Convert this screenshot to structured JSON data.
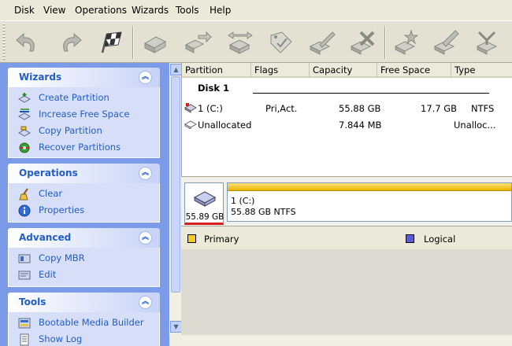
{
  "menu": [
    "Disk",
    "View",
    "Operations",
    "Wizards",
    "Tools",
    "Help"
  ],
  "toolbar": {
    "buttons": [
      "undo-icon",
      "redo-icon",
      "checkered-flag-icon",
      "disk-create-icon",
      "disk-move-icon",
      "disk-resize-icon",
      "disk-label-icon",
      "disk-check-icon",
      "disk-delete-icon",
      "disk-explore-icon",
      "disk-wizard-icon",
      "disk-merge-icon"
    ]
  },
  "panels": {
    "wizards": {
      "title": "Wizards",
      "links": [
        "Create Partition",
        "Increase Free Space",
        "Copy Partition",
        "Recover Partitions"
      ]
    },
    "operations": {
      "title": "Operations",
      "links": [
        "Clear",
        "Properties"
      ]
    },
    "advanced": {
      "title": "Advanced",
      "links": [
        "Copy MBR",
        "Edit"
      ]
    },
    "tools": {
      "title": "Tools",
      "links": [
        "Bootable Media Builder",
        "Show Log"
      ]
    }
  },
  "list": {
    "columns": [
      "Partition",
      "Flags",
      "Capacity",
      "Free Space",
      "Type"
    ],
    "disk_label": "Disk 1",
    "rows": [
      {
        "partition": "1 (C:)",
        "flags": "Pri,Act.",
        "capacity": "55.88 GB",
        "free": "17.7 GB",
        "type": "NTFS"
      },
      {
        "partition": "Unallocated",
        "flags": "",
        "capacity": "7.844 MB",
        "free": "",
        "type": "Unalloc..."
      }
    ]
  },
  "diskmap": {
    "disk_size": "55.89 GB",
    "partition_name": "1 (C:)",
    "partition_detail": "55.88 GB  NTFS"
  },
  "legend": {
    "primary": "Primary",
    "logical": "Logical"
  },
  "colors": {
    "primary": "#f5cc1c",
    "logical": "#5b5bd6",
    "link": "#215dc6"
  }
}
